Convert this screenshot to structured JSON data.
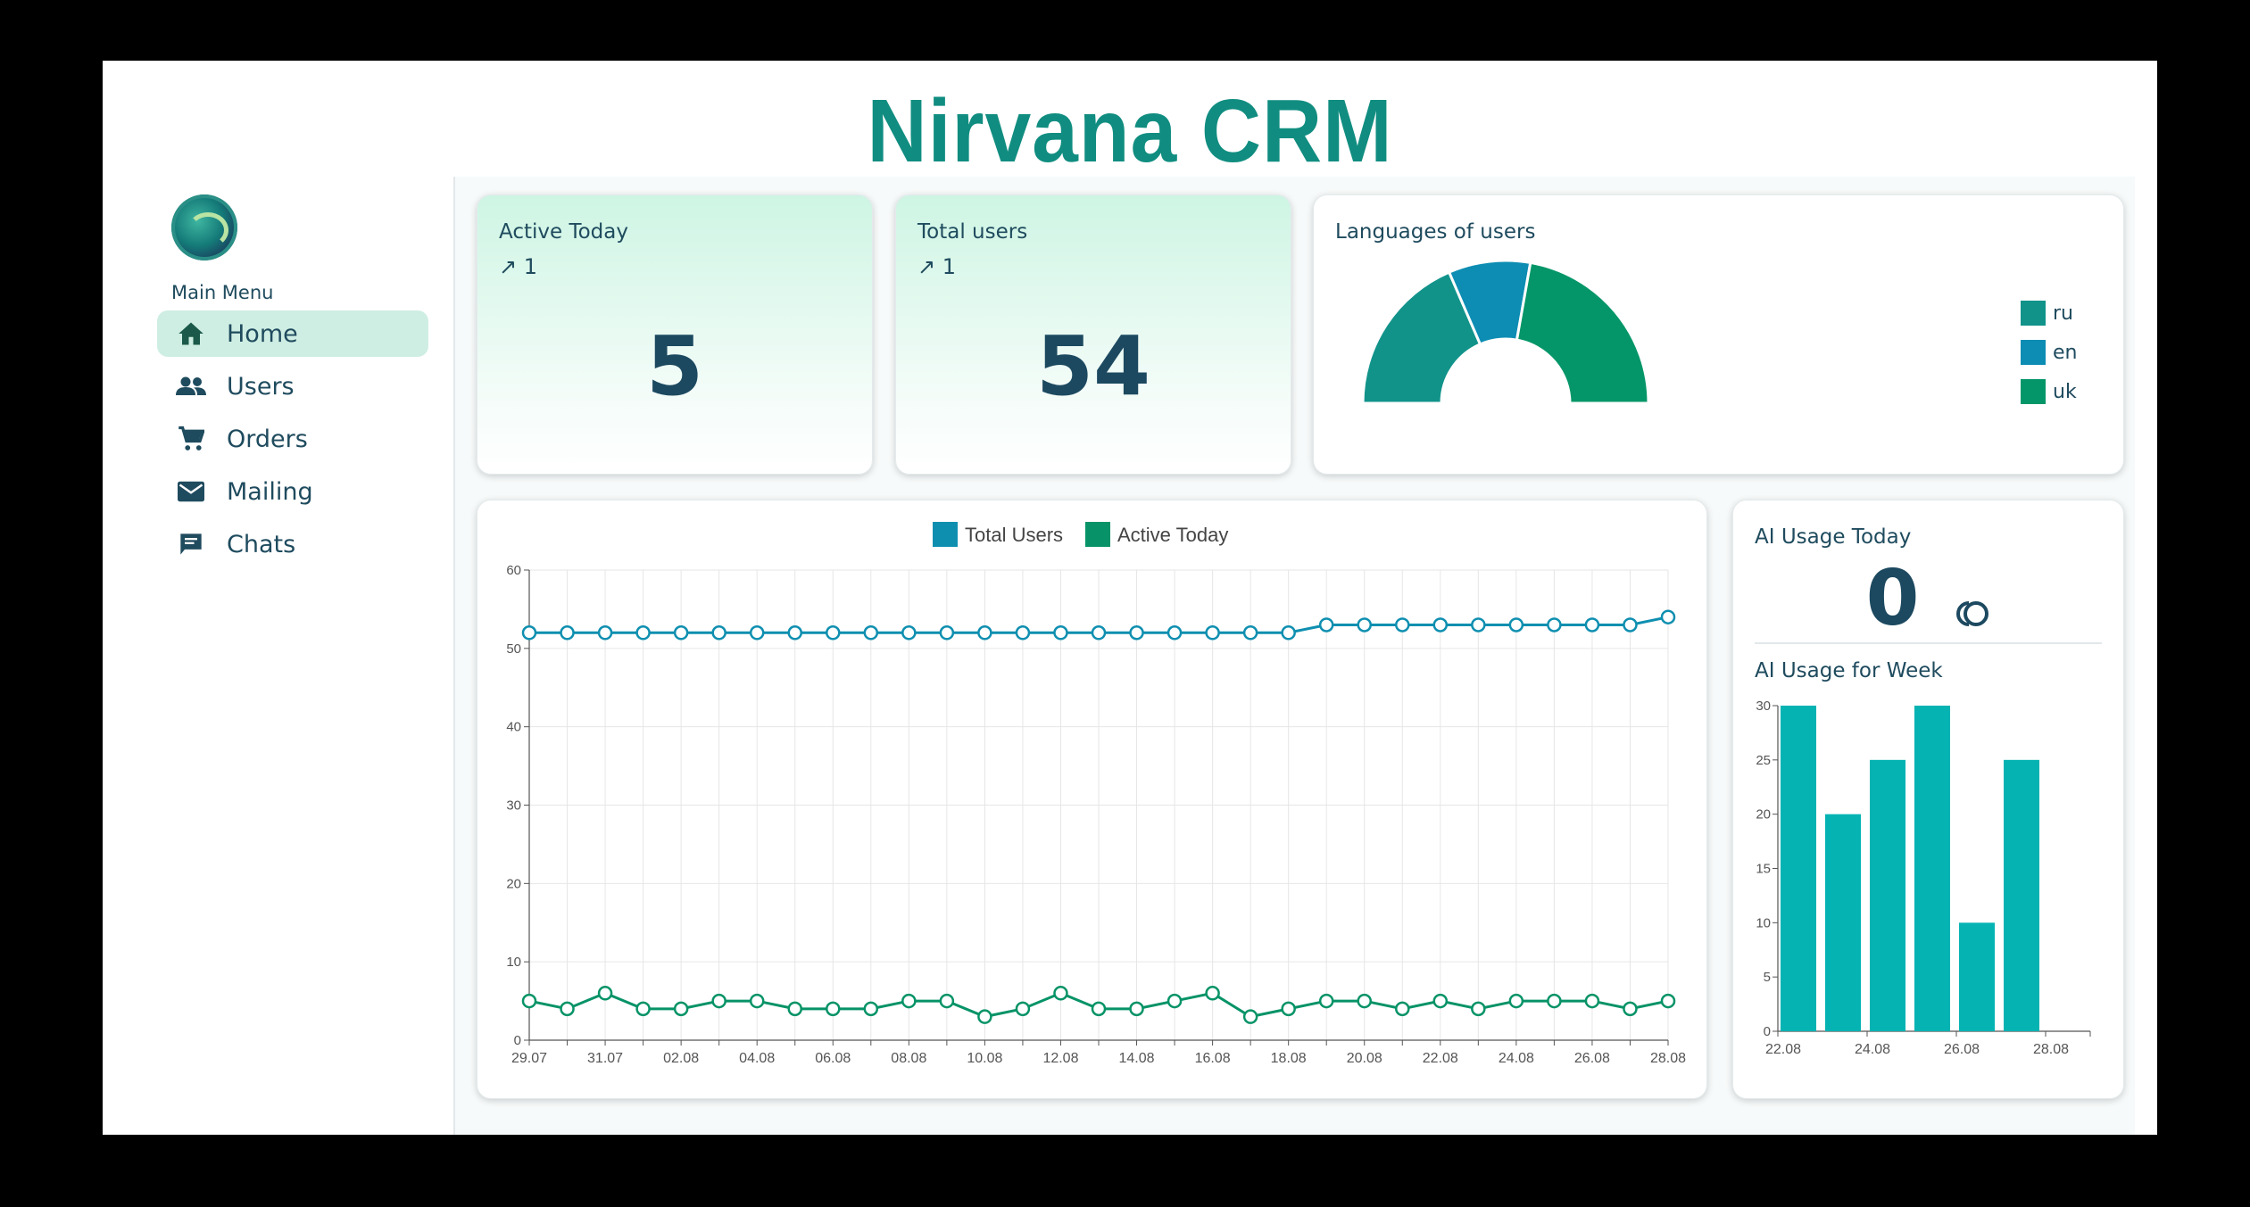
{
  "app": {
    "title": "Nirvana CRM"
  },
  "sidebar": {
    "heading": "Main Menu",
    "items": [
      {
        "label": "Home",
        "icon": "home-icon",
        "active": true
      },
      {
        "label": "Users",
        "icon": "users-icon",
        "active": false
      },
      {
        "label": "Orders",
        "icon": "cart-icon",
        "active": false
      },
      {
        "label": "Mailing",
        "icon": "mail-icon",
        "active": false
      },
      {
        "label": "Chats",
        "icon": "chat-icon",
        "active": false
      }
    ]
  },
  "stats": {
    "active_today": {
      "title": "Active Today",
      "trend": "↗ 1",
      "value": "5"
    },
    "total_users": {
      "title": "Total users",
      "trend": "↗ 1",
      "value": "54"
    }
  },
  "languages": {
    "title": "Languages of users",
    "legend": [
      {
        "label": "ru",
        "color": "#11938a"
      },
      {
        "label": "en",
        "color": "#0d8db3"
      },
      {
        "label": "uk",
        "color": "#049668"
      }
    ]
  },
  "ai": {
    "today_title": "AI Usage Today",
    "today_value": "0",
    "week_title": "AI Usage for Week"
  },
  "colors": {
    "accent": "#108d80",
    "total_users": "#0f8fb0",
    "active_today": "#079367",
    "bars": "#05b3b3"
  },
  "chart_data": [
    {
      "type": "pie",
      "variant": "half-donut",
      "categories": [
        "ru",
        "en",
        "uk"
      ],
      "values": [
        20,
        10,
        24
      ]
    },
    {
      "type": "line",
      "x": [
        "29.07",
        "30.07",
        "31.07",
        "01.08",
        "02.08",
        "03.08",
        "04.08",
        "05.08",
        "06.08",
        "07.08",
        "08.08",
        "09.08",
        "10.08",
        "11.08",
        "12.08",
        "13.08",
        "14.08",
        "15.08",
        "16.08",
        "17.08",
        "18.08",
        "19.08",
        "20.08",
        "21.08",
        "22.08",
        "23.08",
        "24.08",
        "25.08",
        "26.08",
        "27.08",
        "28.08"
      ],
      "xticks": [
        "29.07",
        "31.07",
        "02.08",
        "04.08",
        "06.08",
        "08.08",
        "10.08",
        "12.08",
        "14.08",
        "16.08",
        "18.08",
        "20.08",
        "22.08",
        "24.08",
        "26.08",
        "28.08"
      ],
      "series": [
        {
          "name": "Total Users",
          "values": [
            52,
            52,
            52,
            52,
            52,
            52,
            52,
            52,
            52,
            52,
            52,
            52,
            52,
            52,
            52,
            52,
            52,
            52,
            52,
            52,
            52,
            53,
            53,
            53,
            53,
            53,
            53,
            53,
            53,
            53,
            54
          ]
        },
        {
          "name": "Active Today",
          "values": [
            5,
            4,
            6,
            4,
            4,
            5,
            5,
            4,
            4,
            4,
            5,
            5,
            3,
            4,
            6,
            4,
            4,
            5,
            6,
            3,
            4,
            5,
            5,
            4,
            5,
            4,
            5,
            5,
            5,
            4,
            5
          ]
        }
      ],
      "ylim": [
        0,
        60
      ],
      "yticks": [
        0,
        10,
        20,
        30,
        40,
        50,
        60
      ],
      "grid": true,
      "legend": "top-center"
    },
    {
      "type": "bar",
      "categories": [
        "22.08",
        "23.08",
        "24.08",
        "25.08",
        "26.08",
        "27.08",
        "28.08"
      ],
      "xticks": [
        "22.08",
        "24.08",
        "26.08",
        "28.08"
      ],
      "values": [
        30,
        20,
        25,
        30,
        10,
        25,
        0
      ],
      "ylim": [
        0,
        30
      ],
      "yticks": [
        0,
        5,
        10,
        15,
        20,
        25,
        30
      ]
    }
  ]
}
